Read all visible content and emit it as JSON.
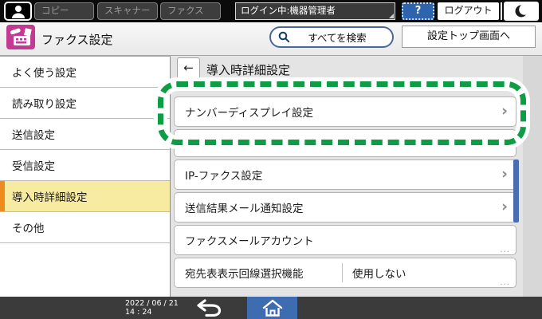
{
  "colors": {
    "topbar_black": "#0b0b0b",
    "accent_blue": "#2e63ae",
    "brand_magenta": "#c23a92",
    "selected_yellow": "#f6eba1",
    "selected_orange": "#ed8b1e",
    "highlight_green": "#0e9c45",
    "scrollbar_blue": "#4a6db2",
    "home_blue": "#3e6cb0"
  },
  "top_bar": {
    "tabs": [
      {
        "label": "コピー"
      },
      {
        "label": "スキャナー"
      },
      {
        "label": "ファクス"
      }
    ],
    "login_status": "ログイン中:機器管理者",
    "help_label": "?",
    "logout_label": "ログアウト"
  },
  "app_header": {
    "title": "ファクス設定",
    "search_label": "すべてを検索",
    "settings_top_label": "設定トップ画面へ"
  },
  "sidebar": {
    "selected_index": 4,
    "items": [
      {
        "label": "よく使う設定"
      },
      {
        "label": "読み取り設定"
      },
      {
        "label": "送信設定"
      },
      {
        "label": "受信設定"
      },
      {
        "label": "導入時詳細設定"
      },
      {
        "label": "その他"
      }
    ]
  },
  "main": {
    "back_glyph": "←",
    "title": "導入時詳細設定",
    "items": [
      {
        "label": "ナンバーディスプレイ設定",
        "highlighted": true
      },
      {
        "label": "IP-ファクス設定"
      },
      {
        "label": "送信結果メール通知設定"
      },
      {
        "label": "ファクスメールアカウント",
        "truncated": true
      },
      {
        "label": "宛先表表示回線選択機能",
        "value": "使用しない",
        "truncated": true
      }
    ]
  },
  "glyphs": {
    "chevron": "›",
    "ellipsis": "..."
  },
  "footer": {
    "date": "2022 / 06 / 21",
    "time": "14 : 24"
  }
}
